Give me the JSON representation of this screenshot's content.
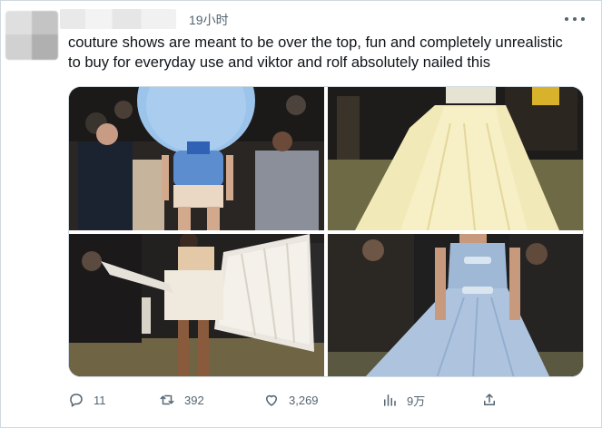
{
  "tweet": {
    "time": "19小时",
    "text": "couture shows are meant to be over the top, fun and completely unrealistic to buy for everyday use and viktor and rolf absolutely nailed this"
  },
  "actions": {
    "replies": "11",
    "retweets": "392",
    "likes": "3,269",
    "views": "9万"
  },
  "icons": [
    "more-icon",
    "reply-icon",
    "retweet-icon",
    "like-icon",
    "views-icon",
    "share-icon"
  ],
  "colors": {
    "text": "#0f1419",
    "muted": "#536471",
    "border": "#cfd9de"
  }
}
